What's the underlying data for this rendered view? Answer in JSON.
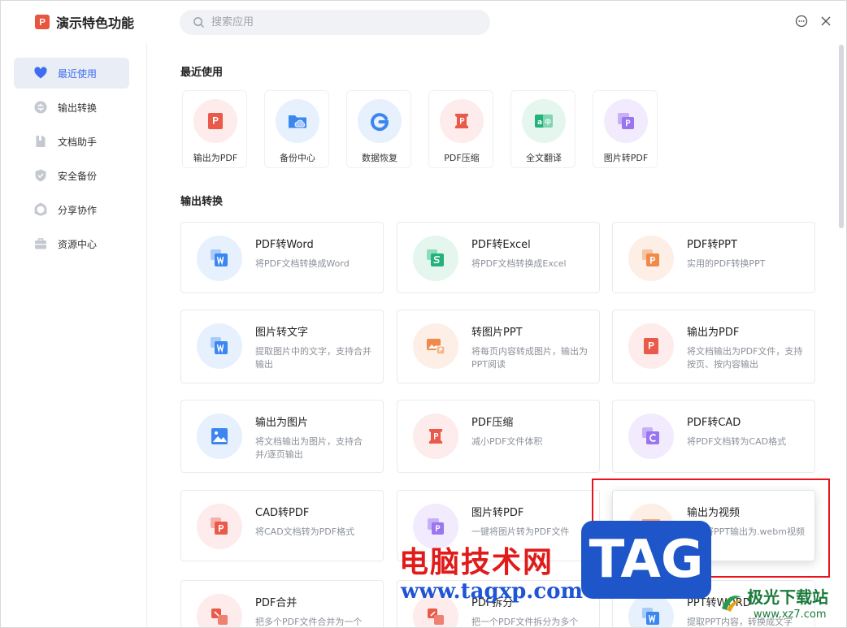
{
  "app": {
    "title": "演示特色功能"
  },
  "search": {
    "placeholder": "搜索应用",
    "value": ""
  },
  "sidebar": {
    "items": [
      {
        "label": "最近使用",
        "icon": "heart-icon",
        "active": true
      },
      {
        "label": "输出转换",
        "icon": "convert-icon",
        "active": false
      },
      {
        "label": "文档助手",
        "icon": "document-icon",
        "active": false
      },
      {
        "label": "安全备份",
        "icon": "shield-icon",
        "active": false
      },
      {
        "label": "分享协作",
        "icon": "share-icon",
        "active": false
      },
      {
        "label": "资源中心",
        "icon": "briefcase-icon",
        "active": false
      }
    ]
  },
  "recent": {
    "title": "最近使用",
    "items": [
      {
        "label": "输出为PDF",
        "icon": "export-pdf-icon"
      },
      {
        "label": "备份中心",
        "icon": "cloud-folder-icon"
      },
      {
        "label": "数据恢复",
        "icon": "recover-g-icon"
      },
      {
        "label": "PDF压缩",
        "icon": "pdf-compress-icon"
      },
      {
        "label": "全文翻译",
        "icon": "translate-icon"
      },
      {
        "label": "图片转PDF",
        "icon": "image-to-pdf-icon"
      }
    ]
  },
  "convert": {
    "title": "输出转换",
    "cards": [
      {
        "title": "PDF转Word",
        "desc": "将PDF文档转换成Word",
        "icon": "pdf-to-word-icon"
      },
      {
        "title": "PDF转Excel",
        "desc": "将PDF文档转换成Excel",
        "icon": "pdf-to-excel-icon"
      },
      {
        "title": "PDF转PPT",
        "desc": "实用的PDF转换PPT",
        "icon": "pdf-to-ppt-icon"
      },
      {
        "title": "图片转文字",
        "desc": "提取图片中的文字，支持合并输出",
        "icon": "image-to-text-icon"
      },
      {
        "title": "转图片PPT",
        "desc": "将每页内容转成图片，输出为PPT阅读",
        "icon": "to-image-ppt-icon"
      },
      {
        "title": "输出为PDF",
        "desc": "将文档输出为PDF文件，支持按页、按内容输出",
        "icon": "export-pdf-icon"
      },
      {
        "title": "输出为图片",
        "desc": "将文档输出为图片，支持合并/逐页输出",
        "icon": "export-image-icon"
      },
      {
        "title": "PDF压缩",
        "desc": "减小PDF文件体积",
        "icon": "pdf-compress-icon"
      },
      {
        "title": "PDF转CAD",
        "desc": "将PDF文档转为CAD格式",
        "icon": "pdf-to-cad-icon"
      },
      {
        "title": "CAD转PDF",
        "desc": "将CAD文档转为PDF格式",
        "icon": "cad-to-pdf-icon"
      },
      {
        "title": "图片转PDF",
        "desc": "一键将图片转为PDF文件",
        "icon": "image-to-pdf-icon"
      },
      {
        "title": "输出为视频",
        "desc": "一键将PPT输出为.webm视频",
        "icon": "export-video-icon"
      },
      {
        "title": "PDF合并",
        "desc": "把多个PDF文件合并为一个",
        "icon": "pdf-merge-icon"
      },
      {
        "title": "PDF拆分",
        "desc": "把一个PDF文件拆分为多个",
        "icon": "pdf-split-icon"
      },
      {
        "title": "PPT转WORD",
        "desc": "提取PPT内容，转换成文字",
        "icon": "ppt-to-word-icon"
      }
    ]
  },
  "watermark": {
    "cn": "电脑技术网",
    "url": "www.tagxp.com",
    "tag": "TAG",
    "site_name": "极光下载站",
    "site_url": "www.xz7.com"
  },
  "colors": {
    "accent": "#3d6df2",
    "active_bg": "#e9edf5",
    "highlight_border": "#e8131b",
    "red_icon": "#ea5a4a",
    "blue_icon": "#3c86f0",
    "green_icon": "#23b27a",
    "orange_icon": "#f08a4b",
    "purple_icon": "#9b74f0"
  }
}
